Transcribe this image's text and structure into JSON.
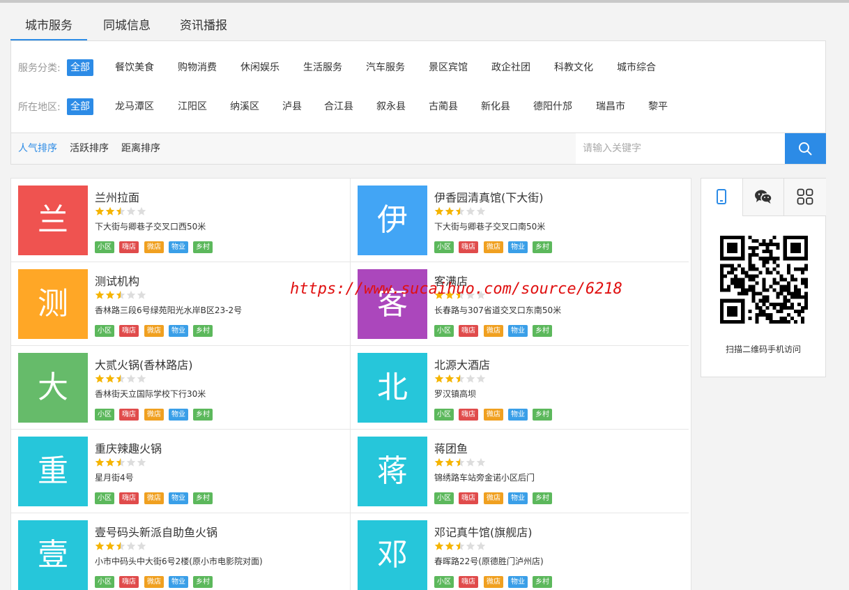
{
  "tabs": [
    {
      "label": "城市服务",
      "active": true
    },
    {
      "label": "同城信息",
      "active": false
    },
    {
      "label": "资讯播报",
      "active": false
    }
  ],
  "filters": {
    "category": {
      "label": "服务分类:",
      "items": [
        "全部",
        "餐饮美食",
        "购物消费",
        "休闲娱乐",
        "生活服务",
        "汽车服务",
        "景区宾馆",
        "政企社团",
        "科教文化",
        "城市综合"
      ],
      "selected": "全部"
    },
    "region": {
      "label": "所在地区:",
      "items": [
        "全部",
        "龙马潭区",
        "江阳区",
        "纳溪区",
        "泸县",
        "合江县",
        "叙永县",
        "古蔺县",
        "新化县",
        "德阳什邡",
        "瑞昌市",
        "黎平"
      ],
      "selected": "全部"
    }
  },
  "sort": {
    "options": [
      "人气排序",
      "活跃排序",
      "距离排序"
    ],
    "active": "人气排序"
  },
  "search": {
    "placeholder": "请输入关键字",
    "icon": "search-icon"
  },
  "tag_styles": [
    {
      "label": "小区",
      "color": "#5cb85c"
    },
    {
      "label": "嗨店",
      "color": "#e04b4b"
    },
    {
      "label": "微店",
      "color": "#f0a020"
    },
    {
      "label": "物业",
      "color": "#3a9fe8"
    },
    {
      "label": "乡村",
      "color": "#5cb85c"
    }
  ],
  "listings": [
    {
      "initial": "兰",
      "color": "#ef5350",
      "name": "兰州拉面",
      "rating": 2.5,
      "address": "下大街与卿巷子交叉口西50米"
    },
    {
      "initial": "伊",
      "color": "#42a5f5",
      "name": "伊香园清真馆(下大街)",
      "rating": 2.5,
      "address": "下大街与卿巷子交叉口南50米"
    },
    {
      "initial": "测",
      "color": "#ffa726",
      "name": "测试机构",
      "rating": 2.5,
      "address": "香林路三段6号绿苑阳光水岸B区23-2号"
    },
    {
      "initial": "客",
      "color": "#ab47bc",
      "name": "客满店",
      "rating": 2.5,
      "address": "长春路与307省道交叉口东南50米"
    },
    {
      "initial": "大",
      "color": "#66bb6a",
      "name": "大贰火锅(香林路店)",
      "rating": 2.5,
      "address": "香林街天立国际学校下行30米"
    },
    {
      "initial": "北",
      "color": "#26c6da",
      "name": "北源大酒店",
      "rating": 2.5,
      "address": "罗汉镇高坝"
    },
    {
      "initial": "重",
      "color": "#26c6da",
      "name": "重庆辣趣火锅",
      "rating": 2.5,
      "address": "星月街4号"
    },
    {
      "initial": "蒋",
      "color": "#26c6da",
      "name": "蒋团鱼",
      "rating": 2.5,
      "address": "锦绣路车站旁金诺小区后门"
    },
    {
      "initial": "壹",
      "color": "#26c6da",
      "name": "壹号码头新派自助鱼火锅",
      "rating": 2.5,
      "address": "小市中码头中大街6号2楼(原小市电影院对面)"
    },
    {
      "initial": "邓",
      "color": "#26c6da",
      "name": "邓记真牛馆(旗舰店)",
      "rating": 2.5,
      "address": "春晖路22号(原德胜门泸州店)"
    }
  ],
  "sidebar": {
    "tabs": [
      "mobile-icon",
      "wechat-icon",
      "apps-icon"
    ],
    "active_tab": "mobile-icon",
    "qr_caption": "扫描二维码手机访问"
  },
  "watermark": "https://www.sucaihuo.com/source/6218",
  "colors": {
    "accent": "#2c8be6",
    "star": "#f5b400",
    "star_empty": "#dddddd"
  }
}
